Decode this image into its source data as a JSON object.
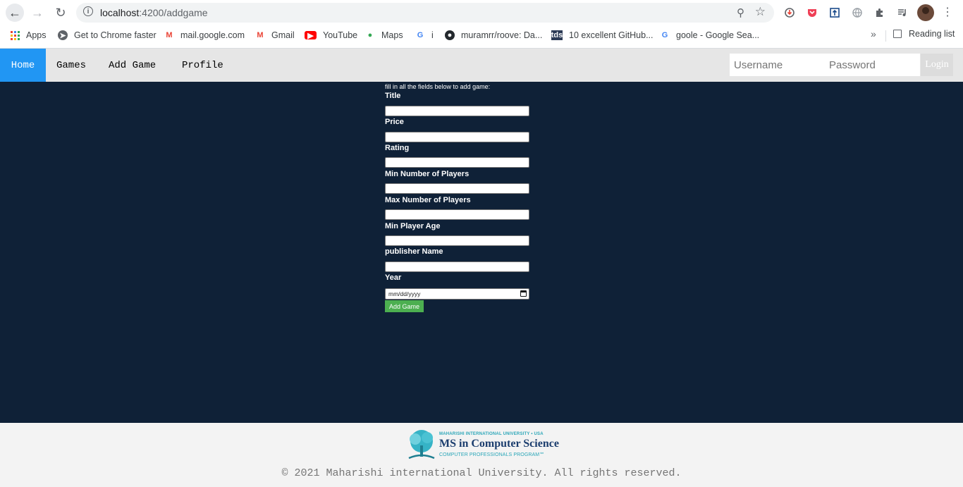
{
  "browser": {
    "url_host": "localhost",
    "url_path": ":4200/addgame",
    "bookmarks": [
      {
        "label": "Apps",
        "icon": "apps-grid-icon"
      },
      {
        "label": "Get to Chrome faster",
        "icon": "chrome-icon"
      },
      {
        "label": "mail.google.com",
        "icon": "gmail-icon"
      },
      {
        "label": "Gmail",
        "icon": "gmail-icon"
      },
      {
        "label": "YouTube",
        "icon": "youtube-icon"
      },
      {
        "label": "Maps",
        "icon": "maps-icon"
      },
      {
        "label": "i",
        "icon": "google-icon"
      },
      {
        "label": "muramrr/roove: Da...",
        "icon": "github-icon"
      },
      {
        "label": "10 excellent GitHub...",
        "icon": "tds-icon"
      },
      {
        "label": "goole - Google Sea...",
        "icon": "google-icon"
      }
    ],
    "more_label": "»",
    "reading_list": "Reading list"
  },
  "nav": {
    "home": "Home",
    "games": "Games",
    "add_game": "Add Game",
    "profile": "Profile",
    "username_placeholder": "Username",
    "password_placeholder": "Password",
    "login": "Login"
  },
  "form": {
    "intro": "fill in all the fields below to add game:",
    "fields": [
      {
        "label": "Title"
      },
      {
        "label": "Price"
      },
      {
        "label": "Rating"
      },
      {
        "label": "Min Number of Players"
      },
      {
        "label": "Max Number of Players"
      },
      {
        "label": "Min Player Age"
      },
      {
        "label": "publisher Name"
      },
      {
        "label": "Year",
        "placeholder": "mm/dd/yyyy"
      }
    ],
    "submit": "Add Game"
  },
  "footer": {
    "logo_small": "MAHARISHI INTERNATIONAL UNIVERSITY • USA",
    "logo_main": "MS in Computer Science",
    "logo_sub": "COMPUTER PROFESSIONALS PROGRAM℠",
    "copyright": "© 2021 Maharishi international University. All rights reserved."
  },
  "colors": {
    "page_bg": "#0f2137",
    "active_nav": "#2196f3",
    "add_button": "#4caf50",
    "footer_bg": "#f3f3f3"
  }
}
